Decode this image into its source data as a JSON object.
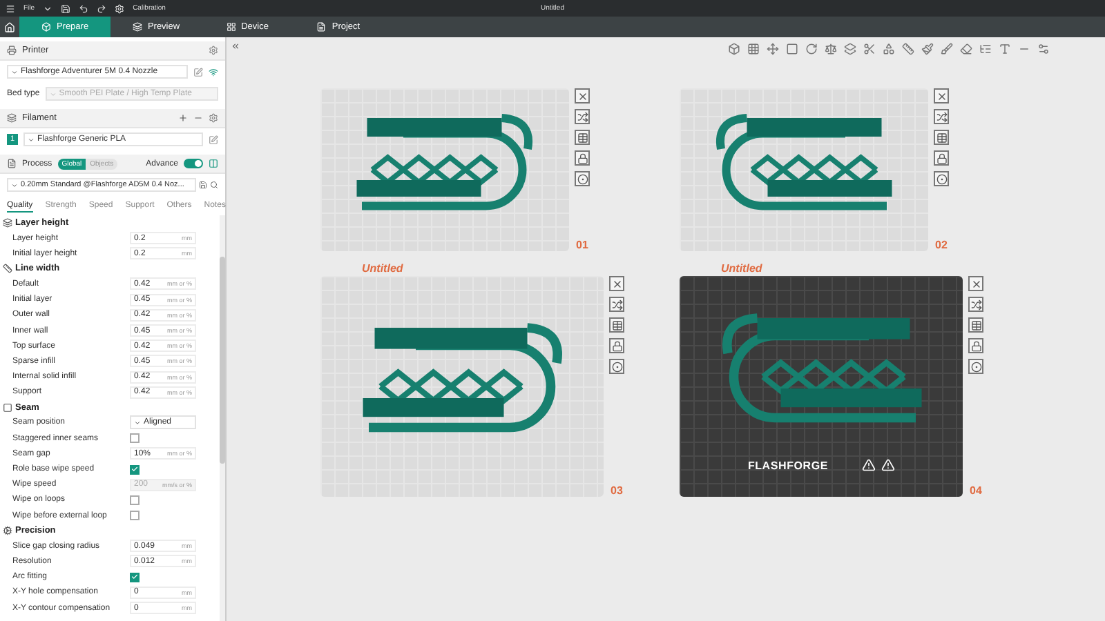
{
  "menu_bar": {
    "menu": "File",
    "title": "Untitled",
    "calibration": "Calibration"
  },
  "tabs": [
    {
      "label": "Prepare",
      "selected": true
    },
    {
      "label": "Preview",
      "selected": false
    },
    {
      "label": "Device",
      "selected": false
    },
    {
      "label": "Project",
      "selected": false
    }
  ],
  "printer": {
    "title": "Printer",
    "preset": "Flashforge Adventurer 5M 0.4 Nozzle",
    "bed_type_label": "Bed type",
    "bed_type": "Smooth PEI Plate / High Temp Plate"
  },
  "filament": {
    "title": "Filament",
    "items": [
      {
        "index": "1",
        "name": "Flashforge Generic PLA",
        "color": "#14967f"
      }
    ]
  },
  "process": {
    "title": "Process",
    "scope": [
      {
        "label": "Global",
        "selected": true
      },
      {
        "label": "Objects",
        "selected": false
      }
    ],
    "advanced_label": "Advance",
    "advanced": true,
    "preset": "0.20mm Standard @Flashforge AD5M 0.4 Noz..."
  },
  "setting_tabs": [
    {
      "label": "Quality",
      "selected": true
    },
    {
      "label": "Strength",
      "selected": false
    },
    {
      "label": "Speed",
      "selected": false
    },
    {
      "label": "Support",
      "selected": false
    },
    {
      "label": "Others",
      "selected": false
    },
    {
      "label": "Notes",
      "selected": false
    }
  ],
  "groups": [
    {
      "title": "Layer height",
      "rows": [
        {
          "kind": "number",
          "label": "Layer height",
          "value": "0.2",
          "unit": "mm",
          "disabled": false
        },
        {
          "kind": "number",
          "label": "Initial layer height",
          "value": "0.2",
          "unit": "mm",
          "disabled": false
        }
      ]
    },
    {
      "title": "Line width",
      "rows": [
        {
          "kind": "number",
          "label": "Default",
          "value": "0.42",
          "unit": "mm or %",
          "disabled": false
        },
        {
          "kind": "number",
          "label": "Initial layer",
          "value": "0.45",
          "unit": "mm or %",
          "disabled": false
        },
        {
          "kind": "number",
          "label": "Outer wall",
          "value": "0.42",
          "unit": "mm or %",
          "disabled": false
        },
        {
          "kind": "number",
          "label": "Inner wall",
          "value": "0.45",
          "unit": "mm or %",
          "disabled": false
        },
        {
          "kind": "number",
          "label": "Top surface",
          "value": "0.42",
          "unit": "mm or %",
          "disabled": false
        },
        {
          "kind": "number",
          "label": "Sparse infill",
          "value": "0.45",
          "unit": "mm or %",
          "disabled": false
        },
        {
          "kind": "number",
          "label": "Internal solid infill",
          "value": "0.42",
          "unit": "mm or %",
          "disabled": false
        },
        {
          "kind": "number",
          "label": "Support",
          "value": "0.42",
          "unit": "mm or %",
          "disabled": false
        }
      ]
    },
    {
      "title": "Seam",
      "rows": [
        {
          "kind": "select",
          "label": "Seam position",
          "value": "Aligned",
          "disabled": false
        },
        {
          "kind": "checkbox",
          "label": "Staggered inner seams",
          "checked": false
        },
        {
          "kind": "number",
          "label": "Seam gap",
          "value": "10%",
          "unit": "mm or %",
          "disabled": false
        },
        {
          "kind": "checkbox",
          "label": "Role base wipe speed",
          "checked": true
        },
        {
          "kind": "number",
          "label": "Wipe speed",
          "value": "200",
          "unit": "mm/s or %",
          "disabled": true
        },
        {
          "kind": "checkbox",
          "label": "Wipe on loops",
          "checked": false
        },
        {
          "kind": "checkbox",
          "label": "Wipe before external loop",
          "checked": false
        }
      ]
    },
    {
      "title": "Precision",
      "rows": [
        {
          "kind": "number",
          "label": "Slice gap closing radius",
          "value": "0.049",
          "unit": "mm",
          "disabled": false
        },
        {
          "kind": "number",
          "label": "Resolution",
          "value": "0.012",
          "unit": "mm",
          "disabled": false
        },
        {
          "kind": "checkbox",
          "label": "Arc fitting",
          "checked": true
        },
        {
          "kind": "number",
          "label": "X-Y hole compensation",
          "value": "0",
          "unit": "mm",
          "disabled": false
        },
        {
          "kind": "number",
          "label": "X-Y contour compensation",
          "value": "0",
          "unit": "mm",
          "disabled": false
        }
      ]
    }
  ],
  "plates": [
    {
      "kind": "cool",
      "number": "01"
    },
    {
      "kind": "cool",
      "number": "02"
    },
    {
      "kind": "cool",
      "label": "Untitled",
      "number": "03"
    },
    {
      "kind": "textured",
      "label": "Untitled",
      "number": "04",
      "brand": "FLASHFORGE"
    }
  ]
}
